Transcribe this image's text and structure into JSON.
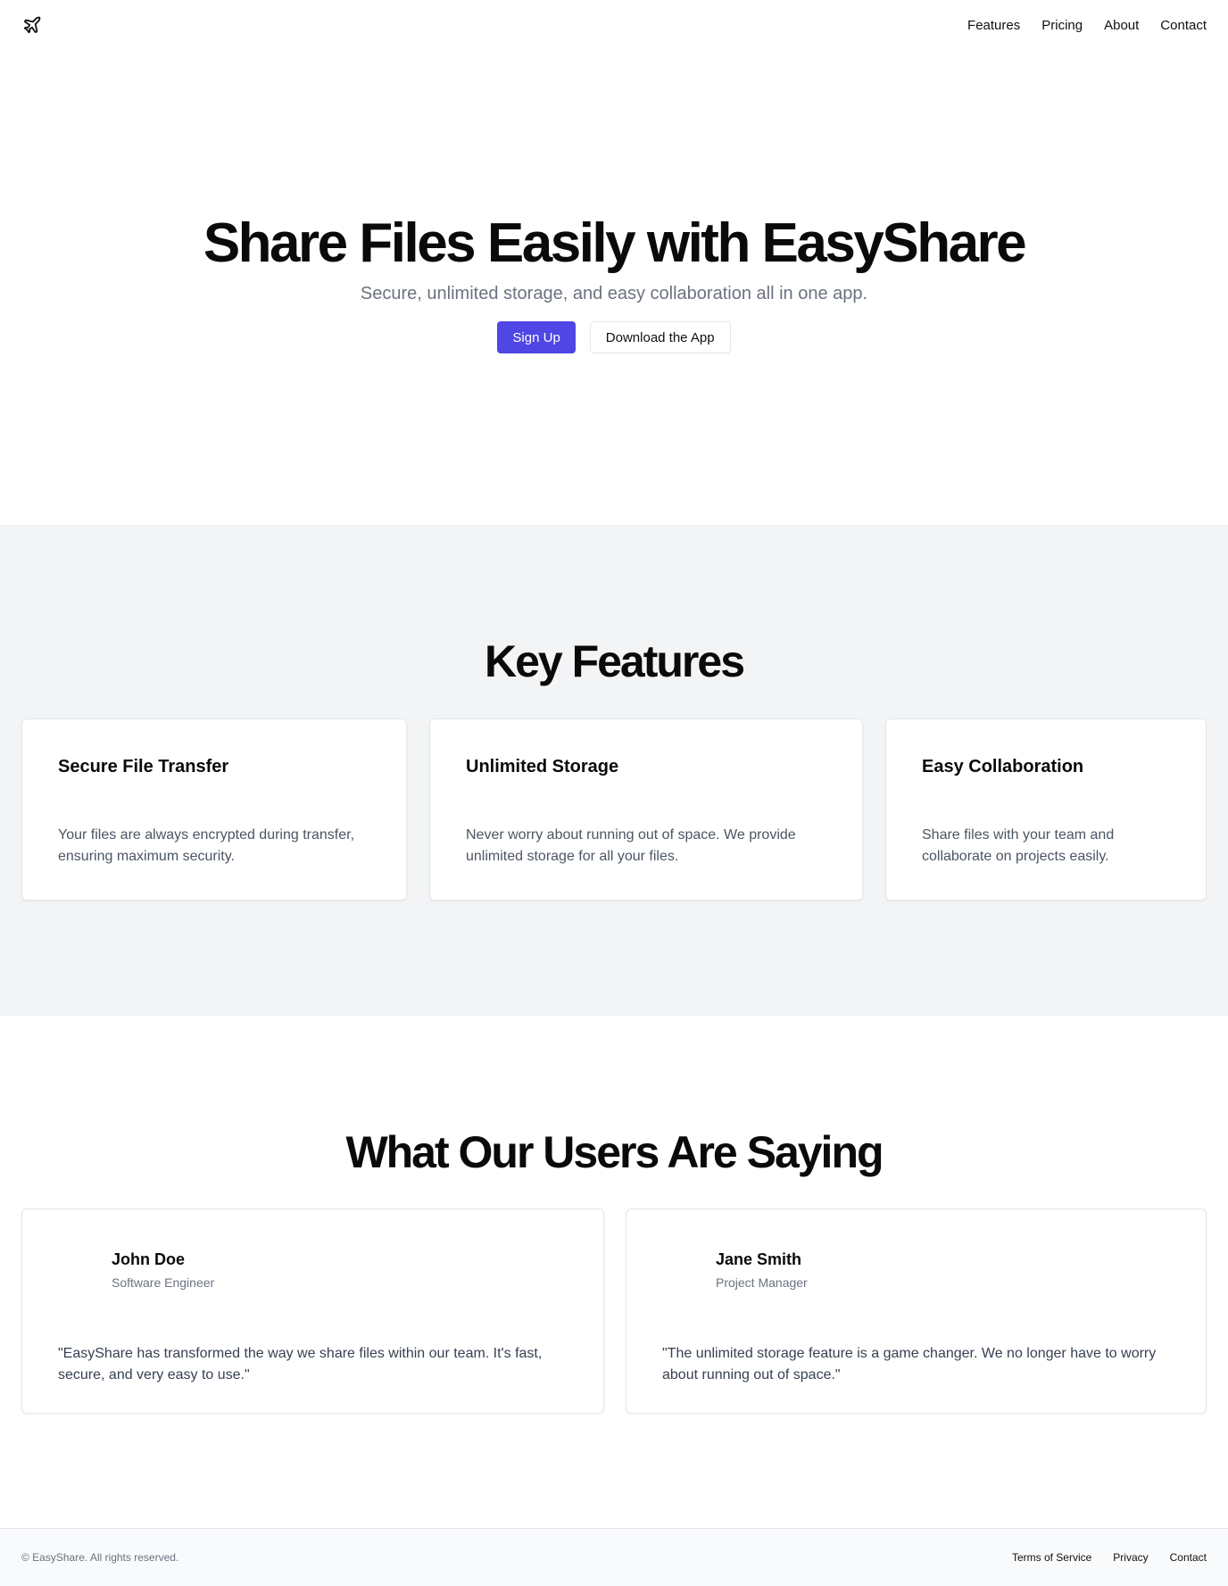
{
  "header": {
    "logo_icon": "plane-icon",
    "nav": [
      "Features",
      "Pricing",
      "About",
      "Contact"
    ]
  },
  "hero": {
    "title": "Share Files Easily with EasyShare",
    "subtitle": "Secure, unlimited storage, and easy collaboration all in one app.",
    "primary_button": "Sign Up",
    "secondary_button": "Download the App"
  },
  "features": {
    "title": "Key Features",
    "items": [
      {
        "title": "Secure File Transfer",
        "description": "Your files are always encrypted during transfer, ensuring maximum security."
      },
      {
        "title": "Unlimited Storage",
        "description": "Never worry about running out of space. We provide unlimited storage for all your files."
      },
      {
        "title": "Easy Collaboration",
        "description": "Share files with your team and collaborate on projects easily."
      }
    ]
  },
  "testimonials": {
    "title": "What Our Users Are Saying",
    "items": [
      {
        "name": "John Doe",
        "role": "Software Engineer",
        "quote": "\"EasyShare has transformed the way we share files within our team. It's fast, secure, and very easy to use.\""
      },
      {
        "name": "Jane Smith",
        "role": "Project Manager",
        "quote": "\"The unlimited storage feature is a game changer. We no longer have to worry about running out of space.\""
      }
    ]
  },
  "footer": {
    "copyright": "© EasyShare. All rights reserved.",
    "links": [
      "Terms of Service",
      "Privacy",
      "Contact"
    ]
  },
  "colors": {
    "accent": "#4f46e5",
    "section_bg": "#f3f4f6",
    "muted_text": "#6b7280"
  }
}
